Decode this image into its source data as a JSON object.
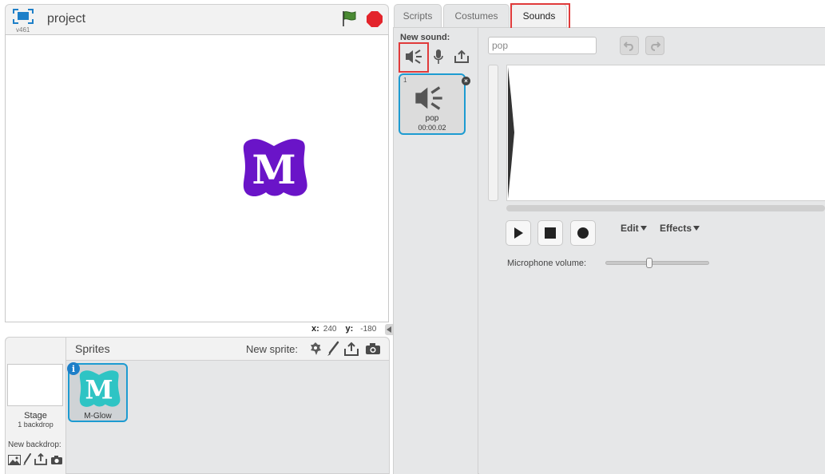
{
  "stage": {
    "version": "v461",
    "project_name": "project",
    "coords": {
      "x_label": "x:",
      "x_value": "240",
      "y_label": "y:",
      "y_value": "-180"
    }
  },
  "sprites_panel": {
    "title": "Sprites",
    "new_sprite_label": "New sprite:",
    "stage_item": {
      "label": "Stage",
      "sublabel": "1 backdrop"
    },
    "new_backdrop_label": "New backdrop:",
    "sprites": [
      {
        "name": "M-Glow"
      }
    ]
  },
  "tabs": [
    {
      "label": "Scripts"
    },
    {
      "label": "Costumes"
    },
    {
      "label": "Sounds"
    }
  ],
  "sounds": {
    "new_sound_label": "New sound:",
    "list": [
      {
        "index": "1",
        "name": "pop",
        "duration": "00:00.02"
      }
    ],
    "name_field_value": "pop",
    "edit_menu": "Edit",
    "effects_menu": "Effects",
    "mic_volume_label": "Microphone volume:",
    "mic_volume_level": 0.42
  },
  "colors": {
    "accent": "#1d9bd1",
    "highlight": "#e03a3a",
    "sprite_purple": "#6a14c8",
    "sprite_teal": "#2ec4c4",
    "flag_green": "#3e7d2f",
    "stop_red": "#e3242b"
  }
}
